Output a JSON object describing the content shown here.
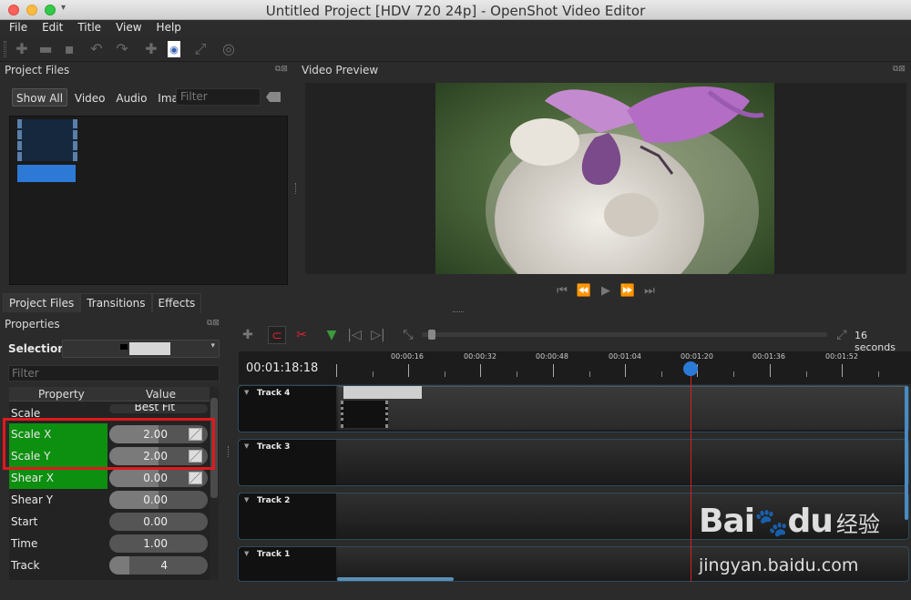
{
  "window": {
    "title": "Untitled Project [HDV 720 24p] - OpenShot Video Editor"
  },
  "menu": [
    "File",
    "Edit",
    "Title",
    "View",
    "Help"
  ],
  "project_files": {
    "header": "Project Files",
    "filters": [
      "Show All",
      "Video",
      "Audio",
      "Image"
    ],
    "filter_placeholder": "Filter",
    "tabs": [
      "Project Files",
      "Transitions",
      "Effects"
    ]
  },
  "video_preview": {
    "header": "Video Preview"
  },
  "properties": {
    "header": "Properties",
    "selection_label": "Selection:",
    "filter_placeholder": "Filter",
    "col_property": "Property",
    "col_value": "Value",
    "rows": [
      {
        "name": "Scale",
        "value": "Best Fit",
        "fill": 0
      },
      {
        "name": "Scale X",
        "value": "2.00",
        "fill": 0.5
      },
      {
        "name": "Scale Y",
        "value": "2.00",
        "fill": 0.5
      },
      {
        "name": "Shear X",
        "value": "0.00",
        "fill": 0.5
      },
      {
        "name": "Shear Y",
        "value": "0.00",
        "fill": 0.5
      },
      {
        "name": "Start",
        "value": "0.00",
        "fill": 0
      },
      {
        "name": "Time",
        "value": "1.00",
        "fill": 0
      },
      {
        "name": "Track",
        "value": "4",
        "fill": 0.2
      }
    ]
  },
  "timeline": {
    "zoom_label": "16 seconds",
    "current_time": "00:01:18:18",
    "ticks": [
      "00:00:16",
      "00:00:32",
      "00:00:48",
      "00:01:04",
      "00:01:20",
      "00:01:36",
      "00:01:52"
    ],
    "tracks": [
      "Track 4",
      "Track 3",
      "Track 2",
      "Track 1"
    ]
  },
  "watermark": {
    "brand": "Bai",
    "brand2": "du",
    "cn": "经验",
    "url": "jingyan.baidu.com"
  }
}
